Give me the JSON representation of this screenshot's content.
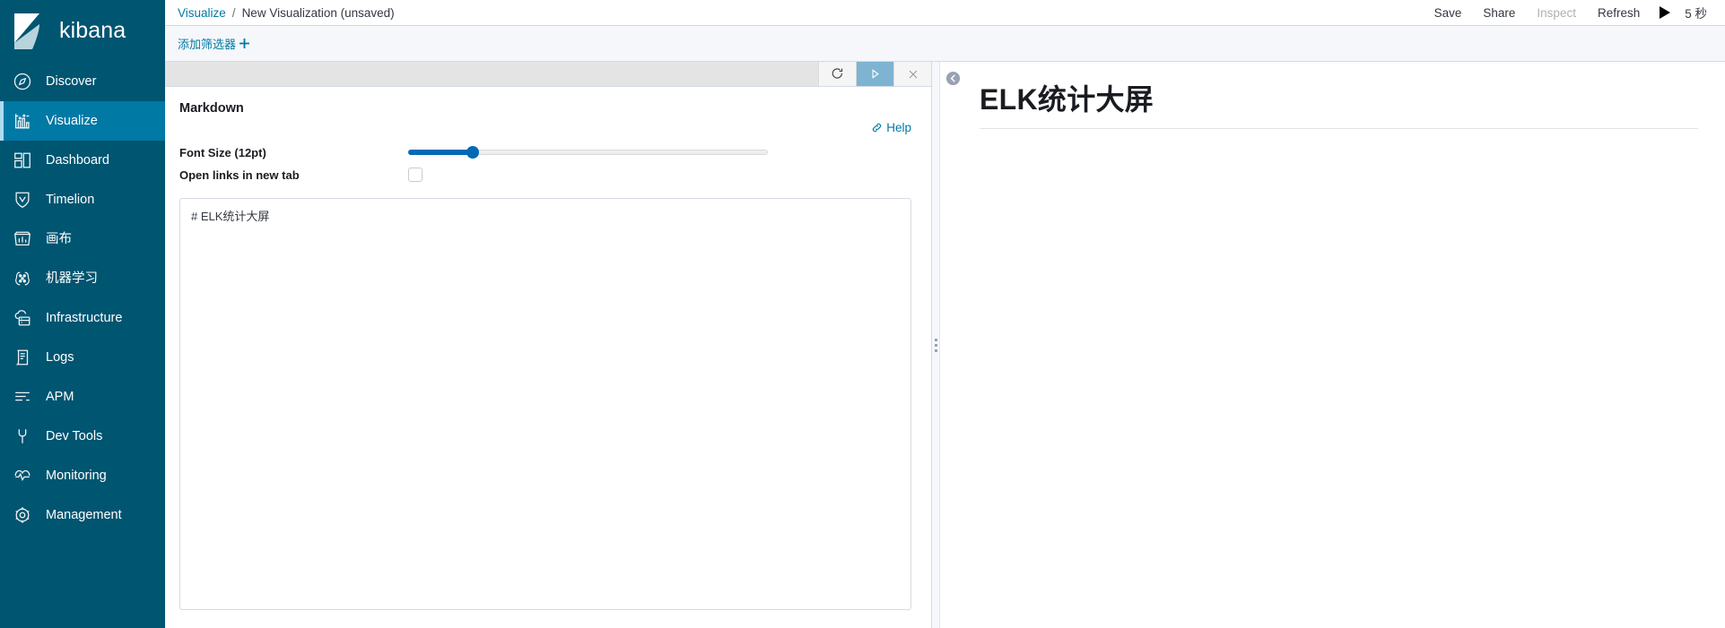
{
  "brand": {
    "name": "kibana",
    "logo_icon": "kibana-logo-icon"
  },
  "sidebar": {
    "items": [
      {
        "label": "Discover",
        "icon": "compass-icon",
        "active": false
      },
      {
        "label": "Visualize",
        "icon": "bar-chart-icon",
        "active": true
      },
      {
        "label": "Dashboard",
        "icon": "dashboard-grid-icon",
        "active": false
      },
      {
        "label": "Timelion",
        "icon": "timelion-shield-icon",
        "active": false
      },
      {
        "label": "画布",
        "icon": "canvas-icon",
        "active": false
      },
      {
        "label": "机器学习",
        "icon": "machine-learning-icon",
        "active": false
      },
      {
        "label": "Infrastructure",
        "icon": "infrastructure-cloud-icon",
        "active": false
      },
      {
        "label": "Logs",
        "icon": "logs-document-icon",
        "active": false
      },
      {
        "label": "APM",
        "icon": "apm-lines-icon",
        "active": false
      },
      {
        "label": "Dev Tools",
        "icon": "wrench-icon",
        "active": false
      },
      {
        "label": "Monitoring",
        "icon": "heartbeat-icon",
        "active": false
      },
      {
        "label": "Management",
        "icon": "gear-icon",
        "active": false
      }
    ]
  },
  "header": {
    "breadcrumb_parent": "Visualize",
    "breadcrumb_separator": "/",
    "breadcrumb_current": "New Visualization (unsaved)",
    "actions": {
      "save": "Save",
      "share": "Share",
      "inspect": "Inspect",
      "refresh": "Refresh",
      "play_icon": "play-triangle-icon",
      "interval": "5 秒"
    }
  },
  "filter_bar": {
    "add_filter_label": "添加筛选器",
    "add_filter_icon": "plus-icon"
  },
  "editor": {
    "toolbar": {
      "refresh_icon": "refresh-circular-arrow-icon",
      "apply_icon": "apply-play-icon",
      "close_icon": "close-x-icon"
    },
    "title": "Markdown",
    "help_label": "Help",
    "help_icon": "link-icon",
    "font_size": {
      "label": "Font Size (12pt)",
      "value": 12,
      "percent": 18
    },
    "open_links_new_tab": {
      "label": "Open links in new tab",
      "checked": false
    },
    "markdown_value": "# ELK统计大屏",
    "markdown_placeholder": ""
  },
  "splitter": {
    "grip_icon": "drag-handle-icon"
  },
  "preview": {
    "collapse_icon": "chevron-left-circle-icon",
    "heading": "ELK统计大屏"
  },
  "colors": {
    "sidebar_bg": "#005571",
    "sidebar_active_bg": "#0079a5",
    "sidebar_accent": "#addcf2",
    "link": "#0079a5",
    "slider_fill": "#006bb4",
    "apply_btn": "#7eb3d2",
    "toolbar_bg": "#e4e4e4",
    "filter_bar_bg": "#f5f7fa",
    "text": "#343741"
  }
}
